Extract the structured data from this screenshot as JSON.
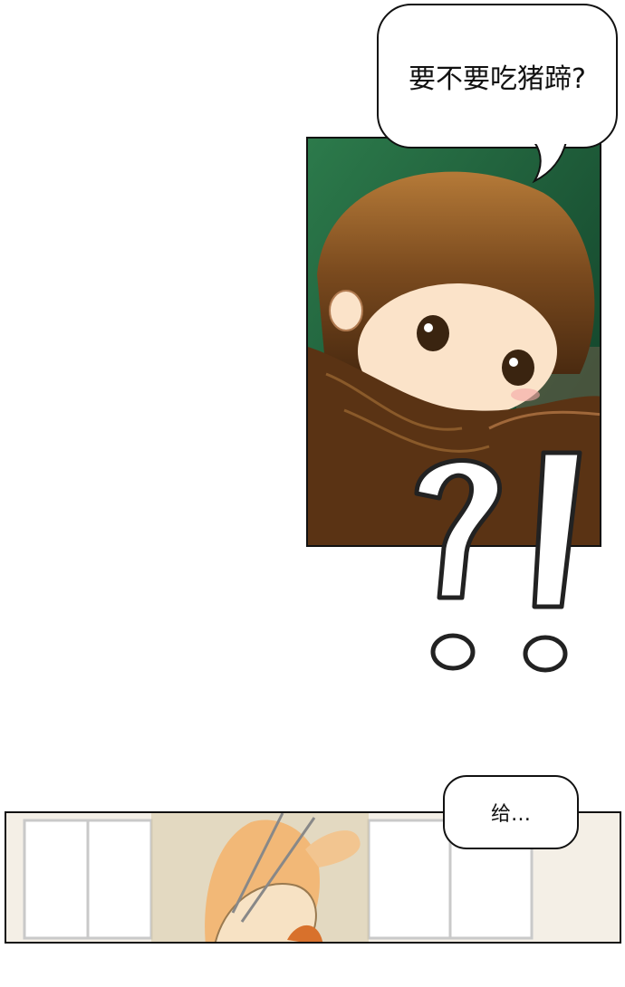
{
  "panels": {
    "top": {
      "speech": "要不要吃猪蹄?"
    },
    "bottom": {
      "speech": "给…"
    }
  },
  "sound_effect": "?!",
  "colors": {
    "panel_bg": "#1f5a3a",
    "hair": "#7a4a1e",
    "skin": "#fbe3c9",
    "ink": "#111111"
  }
}
